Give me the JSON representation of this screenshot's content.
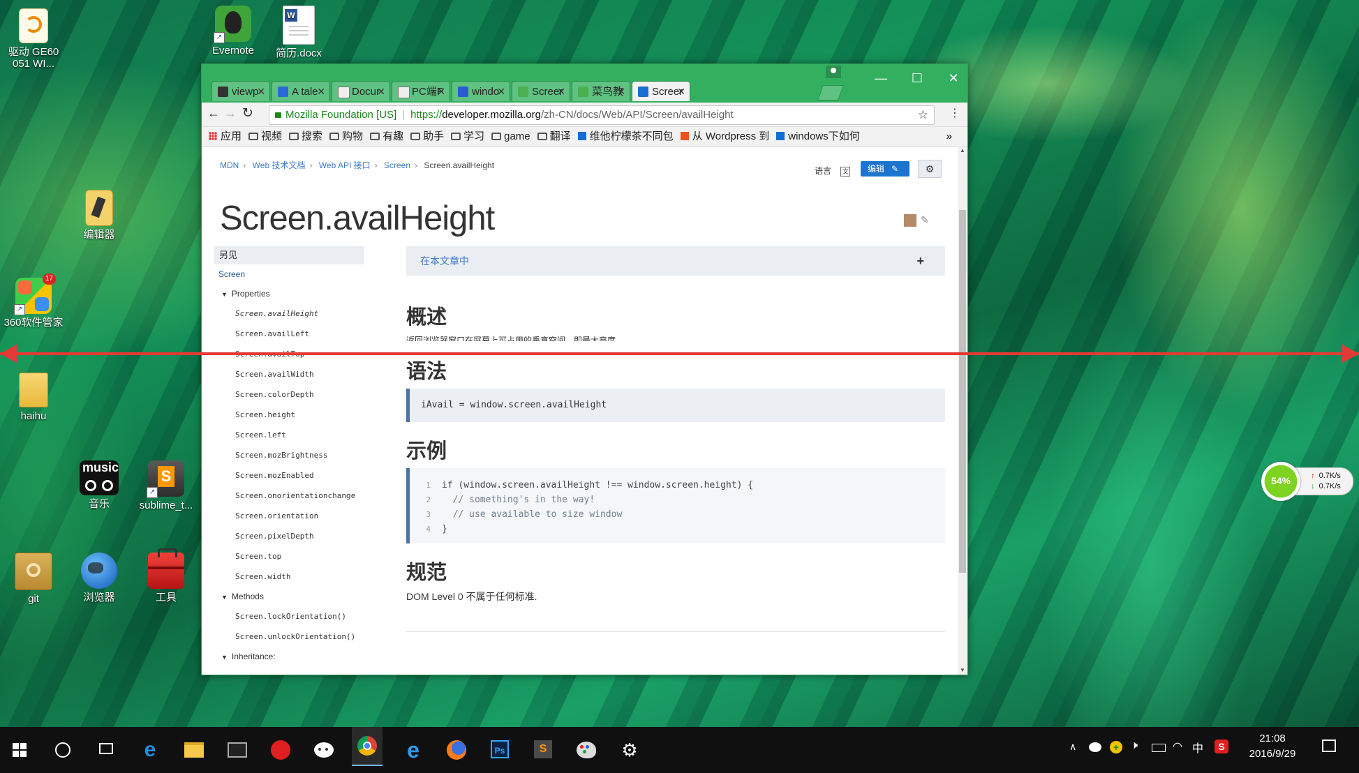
{
  "desktop": {
    "icons": [
      {
        "label": "驱动 GE60\n051 WI...",
        "name": "driver-ge60-icon"
      },
      {
        "label": "Evernote",
        "name": "evernote-icon"
      },
      {
        "label": "简历.docx",
        "name": "resume-docx-icon"
      },
      {
        "label": "编辑器",
        "name": "editor-icon"
      },
      {
        "label": "360软件管家",
        "name": "360-software-manager-icon",
        "badge": "17"
      },
      {
        "label": "haihu",
        "name": "haihu-folder-icon"
      },
      {
        "label": "音乐",
        "name": "music-icon"
      },
      {
        "label": "sublime_t...",
        "name": "sublime-text-icon"
      },
      {
        "label": "git",
        "name": "git-icon"
      },
      {
        "label": "浏览器",
        "name": "browser-icon"
      },
      {
        "label": "工具",
        "name": "tools-icon"
      }
    ],
    "widget": {
      "percent": "54%",
      "up": "0.7K/s",
      "down": "0.7K/s"
    }
  },
  "browser": {
    "tabs": [
      {
        "label": "viewp",
        "icon": "dark"
      },
      {
        "label": "A tale",
        "icon": "blue"
      },
      {
        "label": "Docur",
        "icon": "doc"
      },
      {
        "label": "PC端F",
        "icon": "doc"
      },
      {
        "label": "windo",
        "icon": "paw"
      },
      {
        "label": "Screer",
        "icon": "green"
      },
      {
        "label": "菜鸟教",
        "icon": "green"
      },
      {
        "label": "Screer",
        "icon": "mdn",
        "active": true
      }
    ],
    "address": {
      "site": "Mozilla Foundation [US]",
      "url_scheme": "https://",
      "url_host": "developer.mozilla.org",
      "url_path": "/zh-CN/docs/Web/API/Screen/availHeight"
    },
    "bookmarks": [
      "应用",
      "视频",
      "搜索",
      "购物",
      "有趣",
      "助手",
      "学习",
      "game",
      "翻译",
      "维他柠檬茶不同包",
      "从 Wordpress 到",
      "windows下如何"
    ],
    "bookmarks_more": "»"
  },
  "page": {
    "breadcrumbs": [
      "MDN",
      "Web 技术文档",
      "Web API 接口",
      "Screen",
      "Screen.availHeight"
    ],
    "lang_label": "语言",
    "edit_label": "编辑",
    "title": "Screen.availHeight",
    "sidebar": {
      "heading": "另见",
      "root": "Screen",
      "properties_label": "Properties",
      "properties": [
        "Screen.availHeight",
        "Screen.availLeft",
        "Screen.availTop",
        "Screen.availWidth",
        "Screen.colorDepth",
        "Screen.height",
        "Screen.left",
        "Screen.mozBrightness",
        "Screen.mozEnabled",
        "Screen.onorientationchange",
        "Screen.orientation",
        "Screen.pixelDepth",
        "Screen.top",
        "Screen.width"
      ],
      "methods_label": "Methods",
      "methods": [
        "Screen.lockOrientation()",
        "Screen.unlockOrientation()"
      ],
      "inheritance_label": "Inheritance:"
    },
    "toc_label": "在本文章中",
    "toc_plus": "+",
    "summary_heading": "概述",
    "summary_text": "返回浏览器窗口在屏幕上可占用的垂直空间，即最大高度。",
    "syntax_heading": "语法",
    "syntax_code": "iAvail = window.screen.availHeight",
    "example_heading": "示例",
    "example_lines": [
      {
        "num": "1",
        "code": "if (window.screen.availHeight !== window.screen.height) {"
      },
      {
        "num": "2",
        "code": "  // something's in the way!"
      },
      {
        "num": "3",
        "code": "  // use available to size window"
      },
      {
        "num": "4",
        "code": "}"
      }
    ],
    "spec_heading": "规范",
    "spec_text": "DOM Level 0 不属于任何标准."
  },
  "taskbar": {
    "time": "21:08",
    "date": "2016/9/29",
    "ime": "中"
  }
}
